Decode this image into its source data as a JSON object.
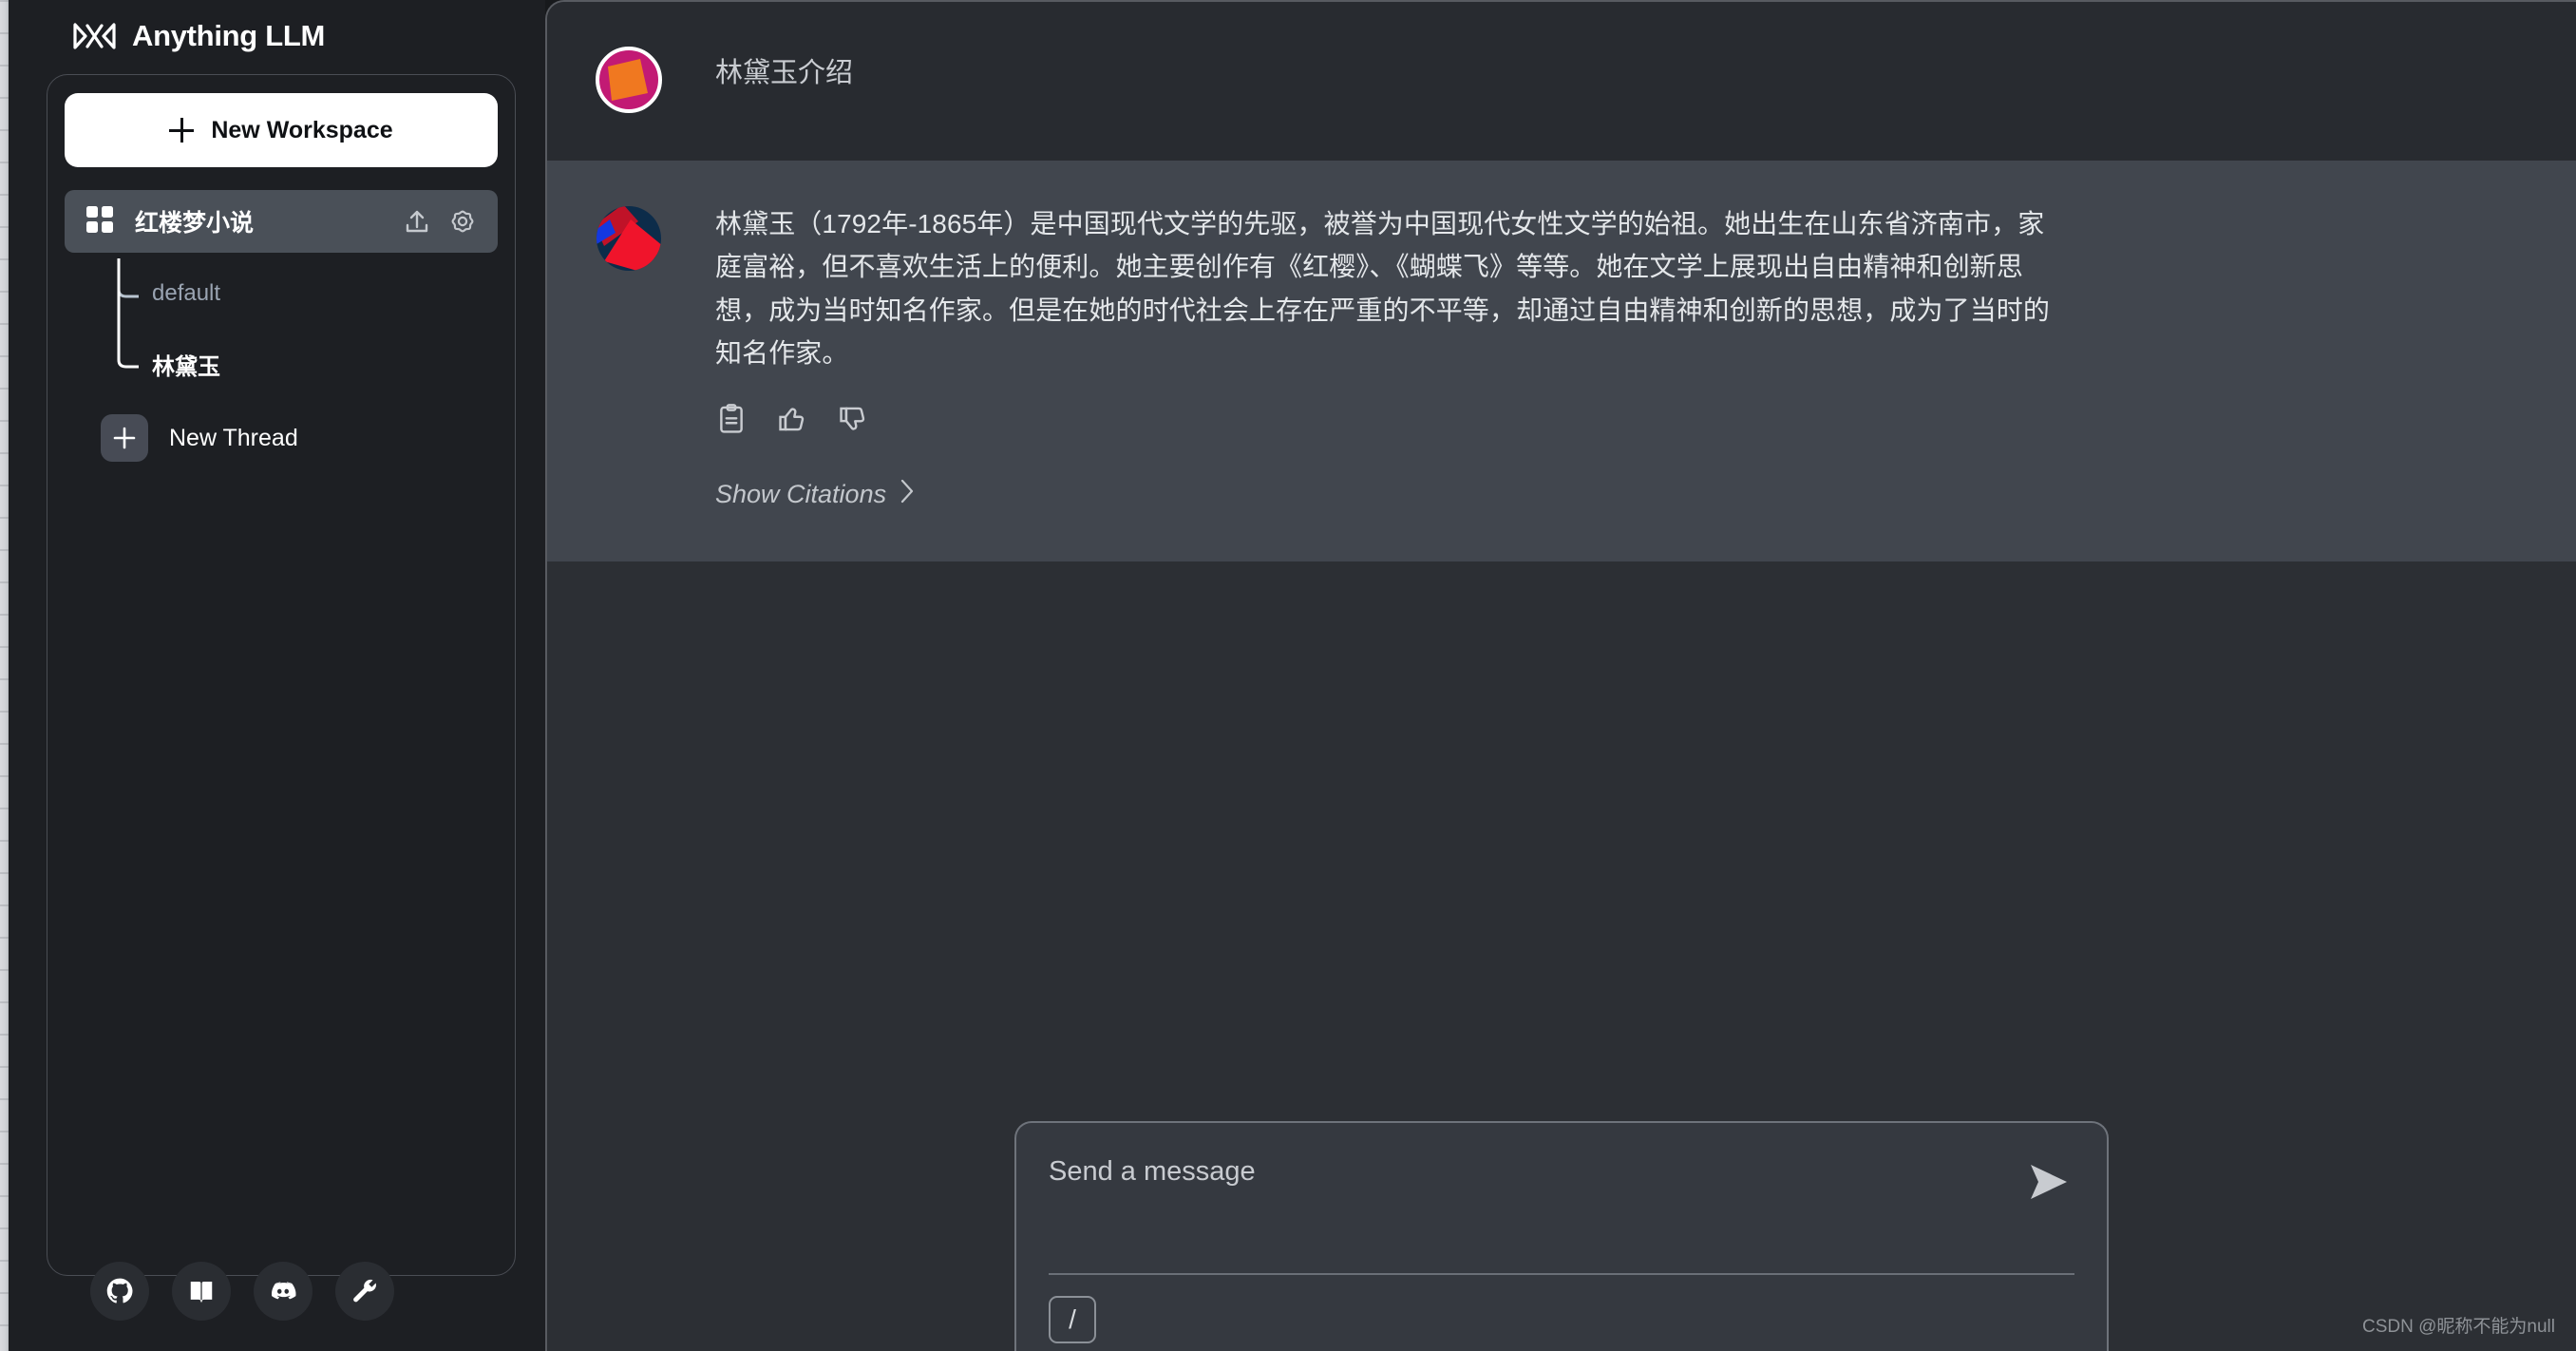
{
  "app": {
    "brand_title": "Anything LLM",
    "brand_logo_icon": "anythingllm-logo-icon"
  },
  "sidebar": {
    "new_workspace_label": "New Workspace",
    "new_workspace_icon": "plus-icon",
    "workspace": {
      "name": "红楼梦小说",
      "grid_icon": "grid-squares-icon",
      "upload_icon": "upload-icon",
      "settings_icon": "gear-icon"
    },
    "threads": [
      {
        "label": "default",
        "active": false
      },
      {
        "label": "林黛玉",
        "active": true
      }
    ],
    "new_thread_label": "New Thread",
    "new_thread_icon": "plus-icon",
    "social": [
      {
        "name": "github-icon",
        "title": "GitHub"
      },
      {
        "name": "book-icon",
        "title": "Docs"
      },
      {
        "name": "discord-icon",
        "title": "Discord"
      },
      {
        "name": "wrench-icon",
        "title": "Settings"
      }
    ]
  },
  "chat": {
    "user_message": {
      "avatar_icon": "user-avatar",
      "avatar_colors": {
        "primary": "#F07820",
        "secondary": "#C21A74",
        "ring": "#FFFFFF"
      },
      "text": "林黛玉介绍"
    },
    "assistant_message": {
      "avatar_icon": "assistant-avatar",
      "avatar_colors": {
        "red": "#F0142B",
        "darkred": "#C01228",
        "navy": "#0C2C4A",
        "blue": "#1438E0"
      },
      "text": "林黛玉（1792年-1865年）是中国现代文学的先驱，被誉为中国现代女性文学的始祖。她出生在山东省济南市，家庭富裕，但不喜欢生活上的便利。她主要创作有《红樱》、《蝴蝶飞》等等。她在文学上展现出自由精神和创新思想，成为当时知名作家。但是在她的时代社会上存在严重的不平等，却通过自由精神和创新的思想，成为了当时的知名作家。",
      "actions": [
        {
          "name": "copy-icon",
          "title": "Copy"
        },
        {
          "name": "thumbs-up-icon",
          "title": "Good response"
        },
        {
          "name": "thumbs-down-icon",
          "title": "Bad response"
        }
      ],
      "citations_label": "Show Citations",
      "citations_chevron_icon": "chevron-right-icon"
    }
  },
  "composer": {
    "placeholder": "Send a message",
    "value": "",
    "send_icon": "send-arrow-icon",
    "slash_label": "/",
    "slash_icon": "slash-command-icon"
  },
  "watermark": {
    "text": "CSDN @昵称不能为null"
  },
  "colors": {
    "sidebar_bg": "#1D1F23",
    "chat_bg": "#2C2F34",
    "user_row_bg": "#282B30",
    "assistant_row_bg": "#41464E",
    "workspace_active_bg": "#4A5058",
    "accent_white": "#FFFFFF"
  }
}
